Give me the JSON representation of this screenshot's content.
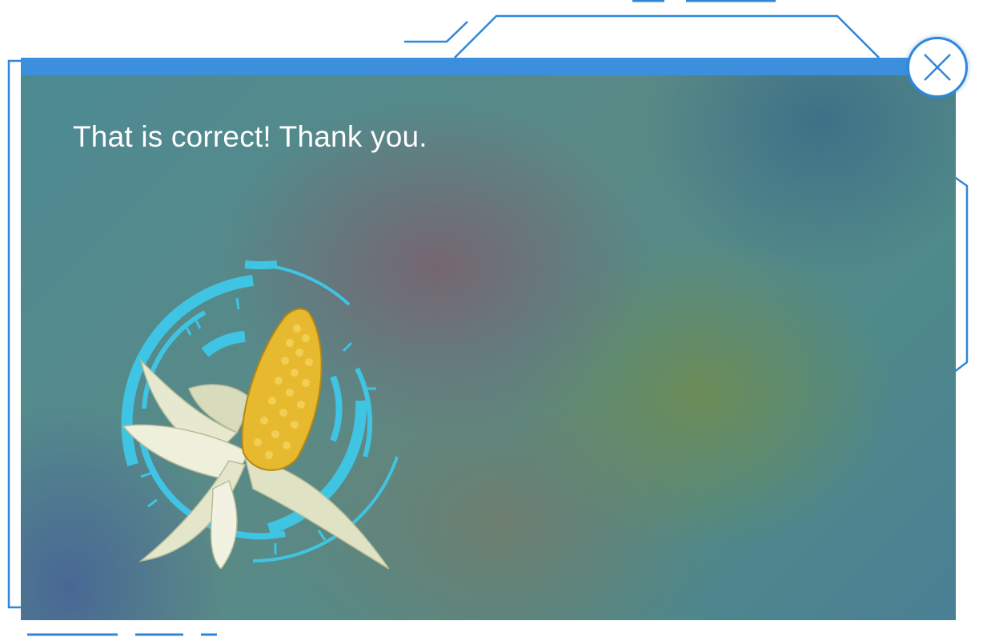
{
  "feedback": {
    "message": "That is correct! Thank you."
  },
  "close_button": {
    "icon": "close-icon"
  },
  "illustration": {
    "subject": "corn-cob",
    "ring_color": "#3fc4e3"
  },
  "colors": {
    "accent": "#2f86db",
    "topbar": "#3b8fdd",
    "text": "#ffffff"
  }
}
